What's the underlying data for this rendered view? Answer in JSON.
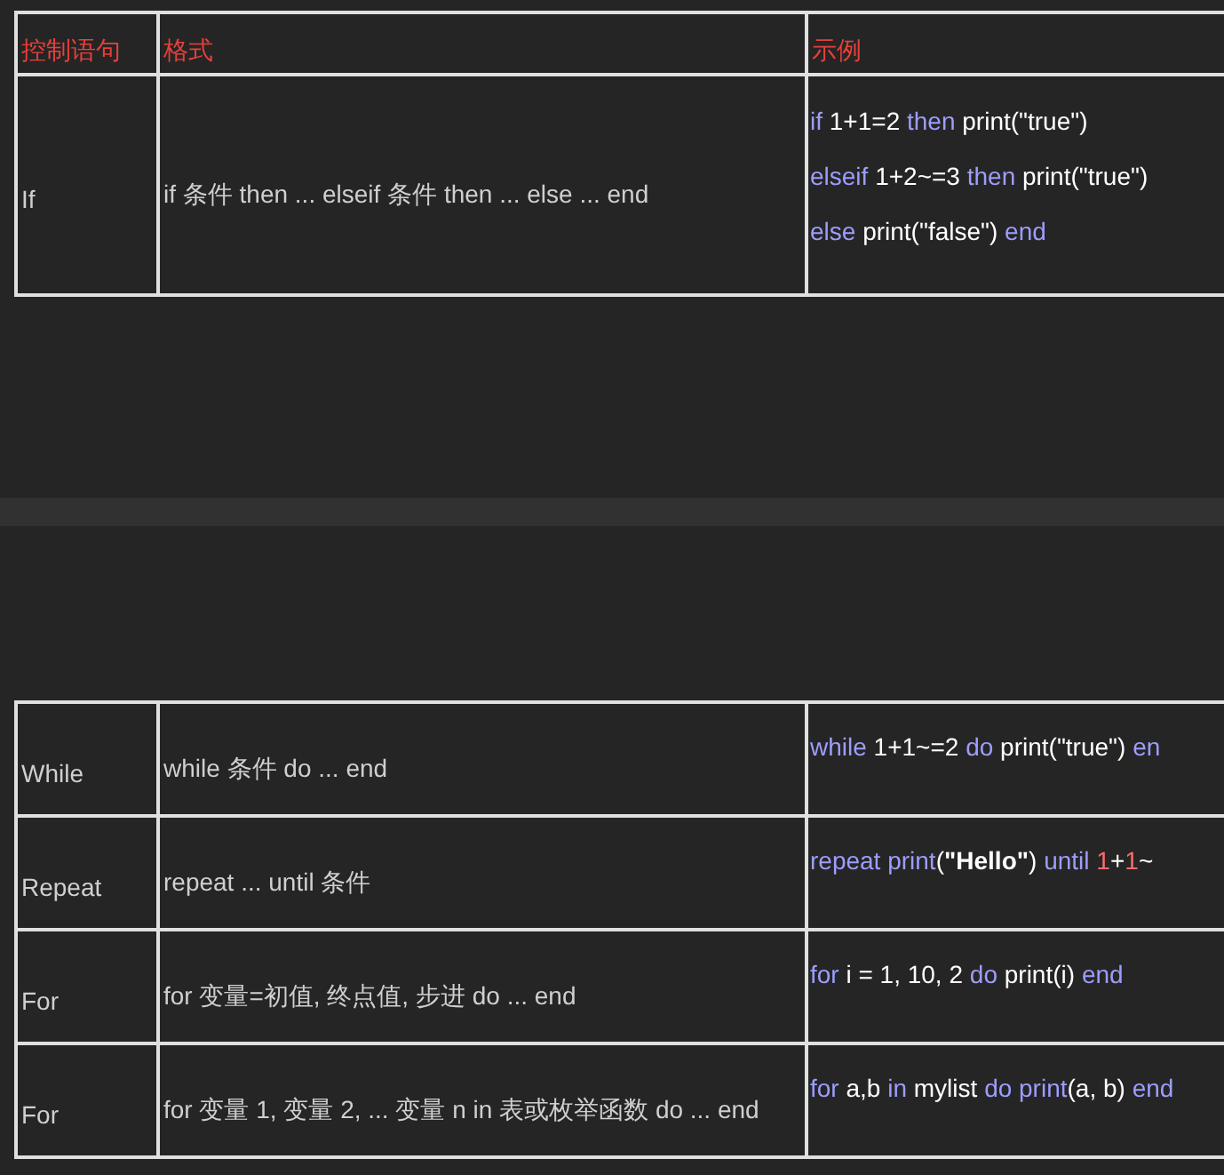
{
  "tables": [
    {
      "header": [
        "控制语句",
        "格式",
        "示例"
      ],
      "rows": [
        {
          "statement": "If",
          "format": "if 条件 then ... elseif 条件 then ... else ... end",
          "example": [
            [
              {
                "kind": "keyword",
                "text": "if"
              },
              {
                "kind": "plain",
                "text": " 1+1=2 "
              },
              {
                "kind": "keyword",
                "text": "then"
              },
              {
                "kind": "plain",
                "text": " print(\"true\")"
              }
            ],
            [
              {
                "kind": "keyword",
                "text": "elseif"
              },
              {
                "kind": "plain",
                "text": " 1+2~=3 "
              },
              {
                "kind": "keyword",
                "text": "then"
              },
              {
                "kind": "plain",
                "text": " print(\"true\")"
              }
            ],
            [
              {
                "kind": "keyword",
                "text": "else"
              },
              {
                "kind": "plain",
                "text": " print(\"false\") "
              },
              {
                "kind": "keyword",
                "text": "end"
              }
            ]
          ]
        }
      ]
    },
    {
      "rows": [
        {
          "statement": "While",
          "format": "while 条件 do ... end",
          "example": [
            [
              {
                "kind": "keyword",
                "text": "while"
              },
              {
                "kind": "plain",
                "text": " 1+1~=2 "
              },
              {
                "kind": "keyword",
                "text": "do"
              },
              {
                "kind": "plain",
                "text": " print(\"true\") "
              },
              {
                "kind": "keyword",
                "text": "en"
              }
            ]
          ]
        },
        {
          "statement": "Repeat",
          "format": "repeat ... until 条件",
          "example": [
            [
              {
                "kind": "keyword",
                "text": "repeat print"
              },
              {
                "kind": "plain",
                "text": "("
              },
              {
                "kind": "strong",
                "text": "\"Hello\""
              },
              {
                "kind": "plain",
                "text": ") "
              },
              {
                "kind": "keyword",
                "text": "until "
              },
              {
                "kind": "number",
                "text": "1"
              },
              {
                "kind": "plain",
                "text": "+"
              },
              {
                "kind": "number",
                "text": "1"
              },
              {
                "kind": "plain",
                "text": "~"
              }
            ]
          ]
        },
        {
          "statement": "For",
          "format": "for 变量=初值, 终点值, 步进 do ... end",
          "example": [
            [
              {
                "kind": "keyword",
                "text": "for"
              },
              {
                "kind": "plain",
                "text": " i = 1, 10, 2 "
              },
              {
                "kind": "keyword",
                "text": "do"
              },
              {
                "kind": "plain",
                "text": " print(i) "
              },
              {
                "kind": "keyword",
                "text": "end"
              }
            ]
          ]
        },
        {
          "statement": "For",
          "format": "for 变量 1, 变量 2, ... 变量 n in 表或枚举函数 do ... end",
          "example": [
            [
              {
                "kind": "keyword",
                "text": "for"
              },
              {
                "kind": "plain",
                "text": " a,b "
              },
              {
                "kind": "keyword",
                "text": "in"
              },
              {
                "kind": "plain",
                "text": " mylist "
              },
              {
                "kind": "keyword",
                "text": "do print"
              },
              {
                "kind": "plain",
                "text": "(a, b) "
              },
              {
                "kind": "keyword",
                "text": "end"
              }
            ]
          ]
        }
      ]
    }
  ]
}
